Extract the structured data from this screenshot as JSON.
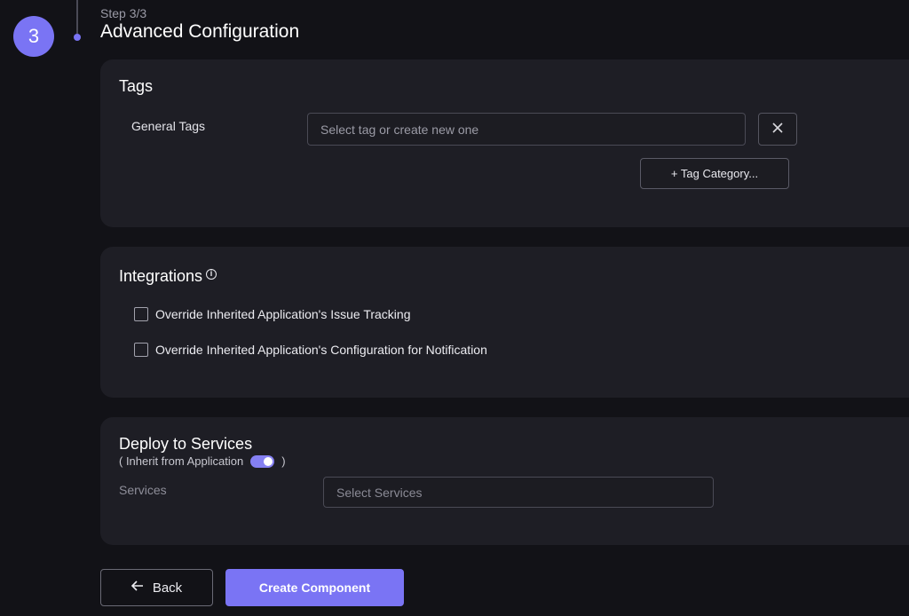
{
  "stepper": {
    "number": "3",
    "subtitle": "Step 3/3",
    "title": "Advanced Configuration"
  },
  "tags_section": {
    "title": "Tags",
    "general_tags_label": "General Tags",
    "tag_input_placeholder": "Select tag or create new one",
    "clear_icon": "close-icon",
    "tag_category_button": "+ Tag Category..."
  },
  "integrations_section": {
    "title": "Integrations",
    "info_icon": "info-icon",
    "options": [
      {
        "label": "Override Inherited Application's Issue Tracking",
        "checked": false
      },
      {
        "label": "Override Inherited Application's Configuration for Notification",
        "checked": false
      }
    ]
  },
  "deploy_section": {
    "title": "Deploy to Services",
    "inherit_open": "( Inherit from Application",
    "inherit_close": ")",
    "inherit_enabled": true,
    "services_label": "Services",
    "services_placeholder": "Select Services"
  },
  "footer": {
    "back_label": "Back",
    "create_label": "Create Component"
  },
  "colors": {
    "accent": "#7a74f4",
    "background": "#121217",
    "card": "#1e1e25"
  }
}
